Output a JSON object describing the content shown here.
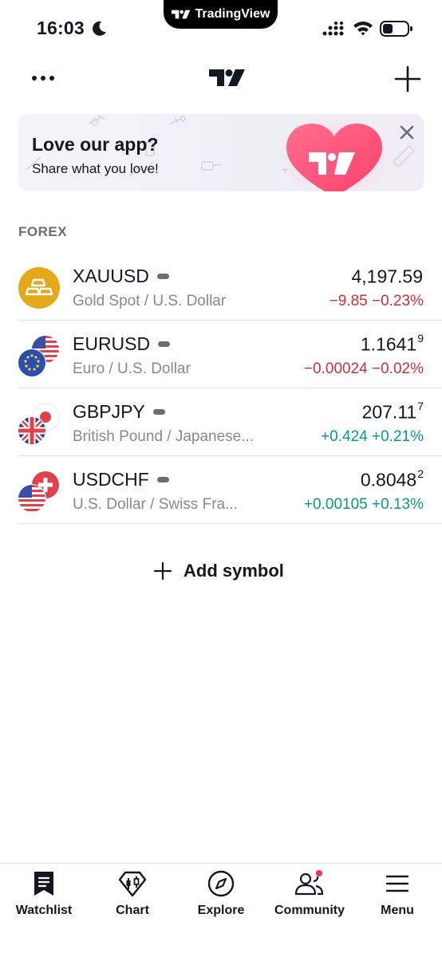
{
  "status_bar": {
    "time": "16:03",
    "island_label": "TradingView"
  },
  "banner": {
    "title": "Love our app?",
    "subtitle": "Share what you love!"
  },
  "section": {
    "title": "FOREX"
  },
  "symbols": [
    {
      "symbol": "XAUUSD",
      "description": "Gold Spot / U.S. Dollar",
      "price": "4,197.59",
      "price_sup": "",
      "change": "−9.85",
      "change_pct": "−0.23%",
      "direction": "down",
      "icon": "gold-bars-icon"
    },
    {
      "symbol": "EURUSD",
      "description": "Euro / U.S. Dollar",
      "price": "1.1641",
      "price_sup": "9",
      "change": "−0.00024",
      "change_pct": "−0.02%",
      "direction": "down",
      "icon": "eur-usd-flags-icon"
    },
    {
      "symbol": "GBPJPY",
      "description": "British Pound / Japanese...",
      "price": "207.11",
      "price_sup": "7",
      "change": "+0.424",
      "change_pct": "+0.21%",
      "direction": "up",
      "icon": "gbp-jpy-flags-icon"
    },
    {
      "symbol": "USDCHF",
      "description": "U.S. Dollar / Swiss Fra...",
      "price": "0.8048",
      "price_sup": "2",
      "change": "+0.00105",
      "change_pct": "+0.13%",
      "direction": "up",
      "icon": "usd-chf-flags-icon"
    }
  ],
  "add_symbol": {
    "label": "Add symbol"
  },
  "nav": {
    "watchlist": "Watchlist",
    "chart": "Chart",
    "explore": "Explore",
    "community": "Community",
    "menu": "Menu"
  },
  "colors": {
    "negative": "#cc2f3c",
    "positive": "#089981",
    "text": "#131722",
    "muted": "#868993",
    "gold": "#e3a91b"
  }
}
